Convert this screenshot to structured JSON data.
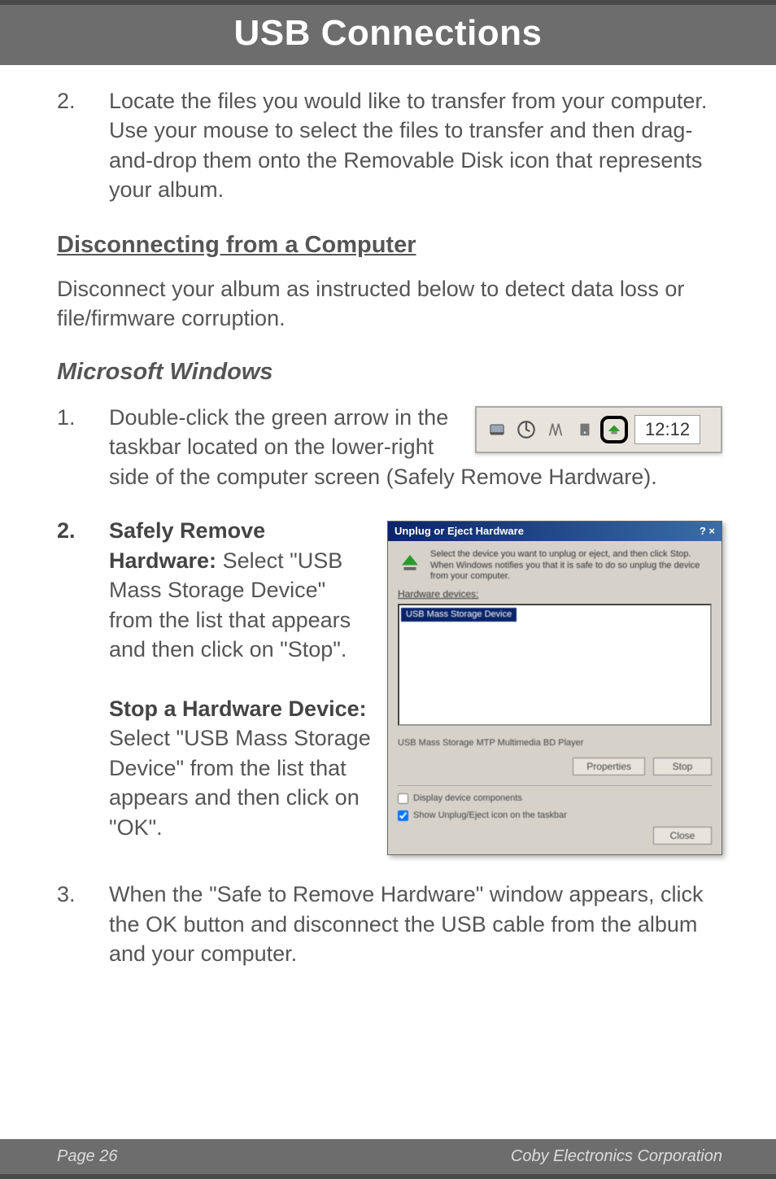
{
  "header": {
    "title": "USB Connections"
  },
  "step2": {
    "num": "2.",
    "text": "Locate the files you would like to transfer from your computer. Use your mouse to select the files to transfer and then drag-and-drop them onto the Removable Disk icon that represents your album."
  },
  "disconnect": {
    "heading": "Disconnecting from a Computer",
    "intro": "Disconnect your album as instructed below to detect data loss or file/firmware corruption."
  },
  "windows": {
    "heading": "Microsoft Windows",
    "s1": {
      "num": "1.",
      "text": "Double-click the green arrow in the taskbar located on the lower-right side of the computer screen (Safely Remove Hardware)."
    },
    "s2": {
      "num": "2.",
      "h1": "Safely Remove Hardware:",
      "t1": " Select \"USB Mass Storage Device\" from the list that appears and then click on \"Stop\".",
      "h2": "Stop a Hardware Device:",
      "t2": " Select \"USB Mass Storage Device\" from the list that appears and then click on \"OK\"."
    },
    "s3": {
      "num": "3.",
      "text": "When the \"Safe to Remove Hardware\" window appears, click the OK button and disconnect the USB cable from the album and your computer."
    }
  },
  "taskbar": {
    "time": "12:12"
  },
  "dialog": {
    "title": "Unplug or Eject Hardware",
    "winbtns": "? ×",
    "instr": "Select the device you want to unplug or eject, and then click Stop. When Windows notifies you that it is safe to do so unplug the device from your computer.",
    "list_label": "Hardware devices:",
    "item": "USB Mass Storage Device",
    "desc": "USB Mass Storage MTP Multimedia BD Player",
    "btn_props": "Properties",
    "btn_stop": "Stop",
    "chk1": "Display device components",
    "chk2": "Show Unplug/Eject icon on the taskbar",
    "btn_close": "Close"
  },
  "footer": {
    "page": "Page 26",
    "corp": "Coby Electronics Corporation"
  }
}
